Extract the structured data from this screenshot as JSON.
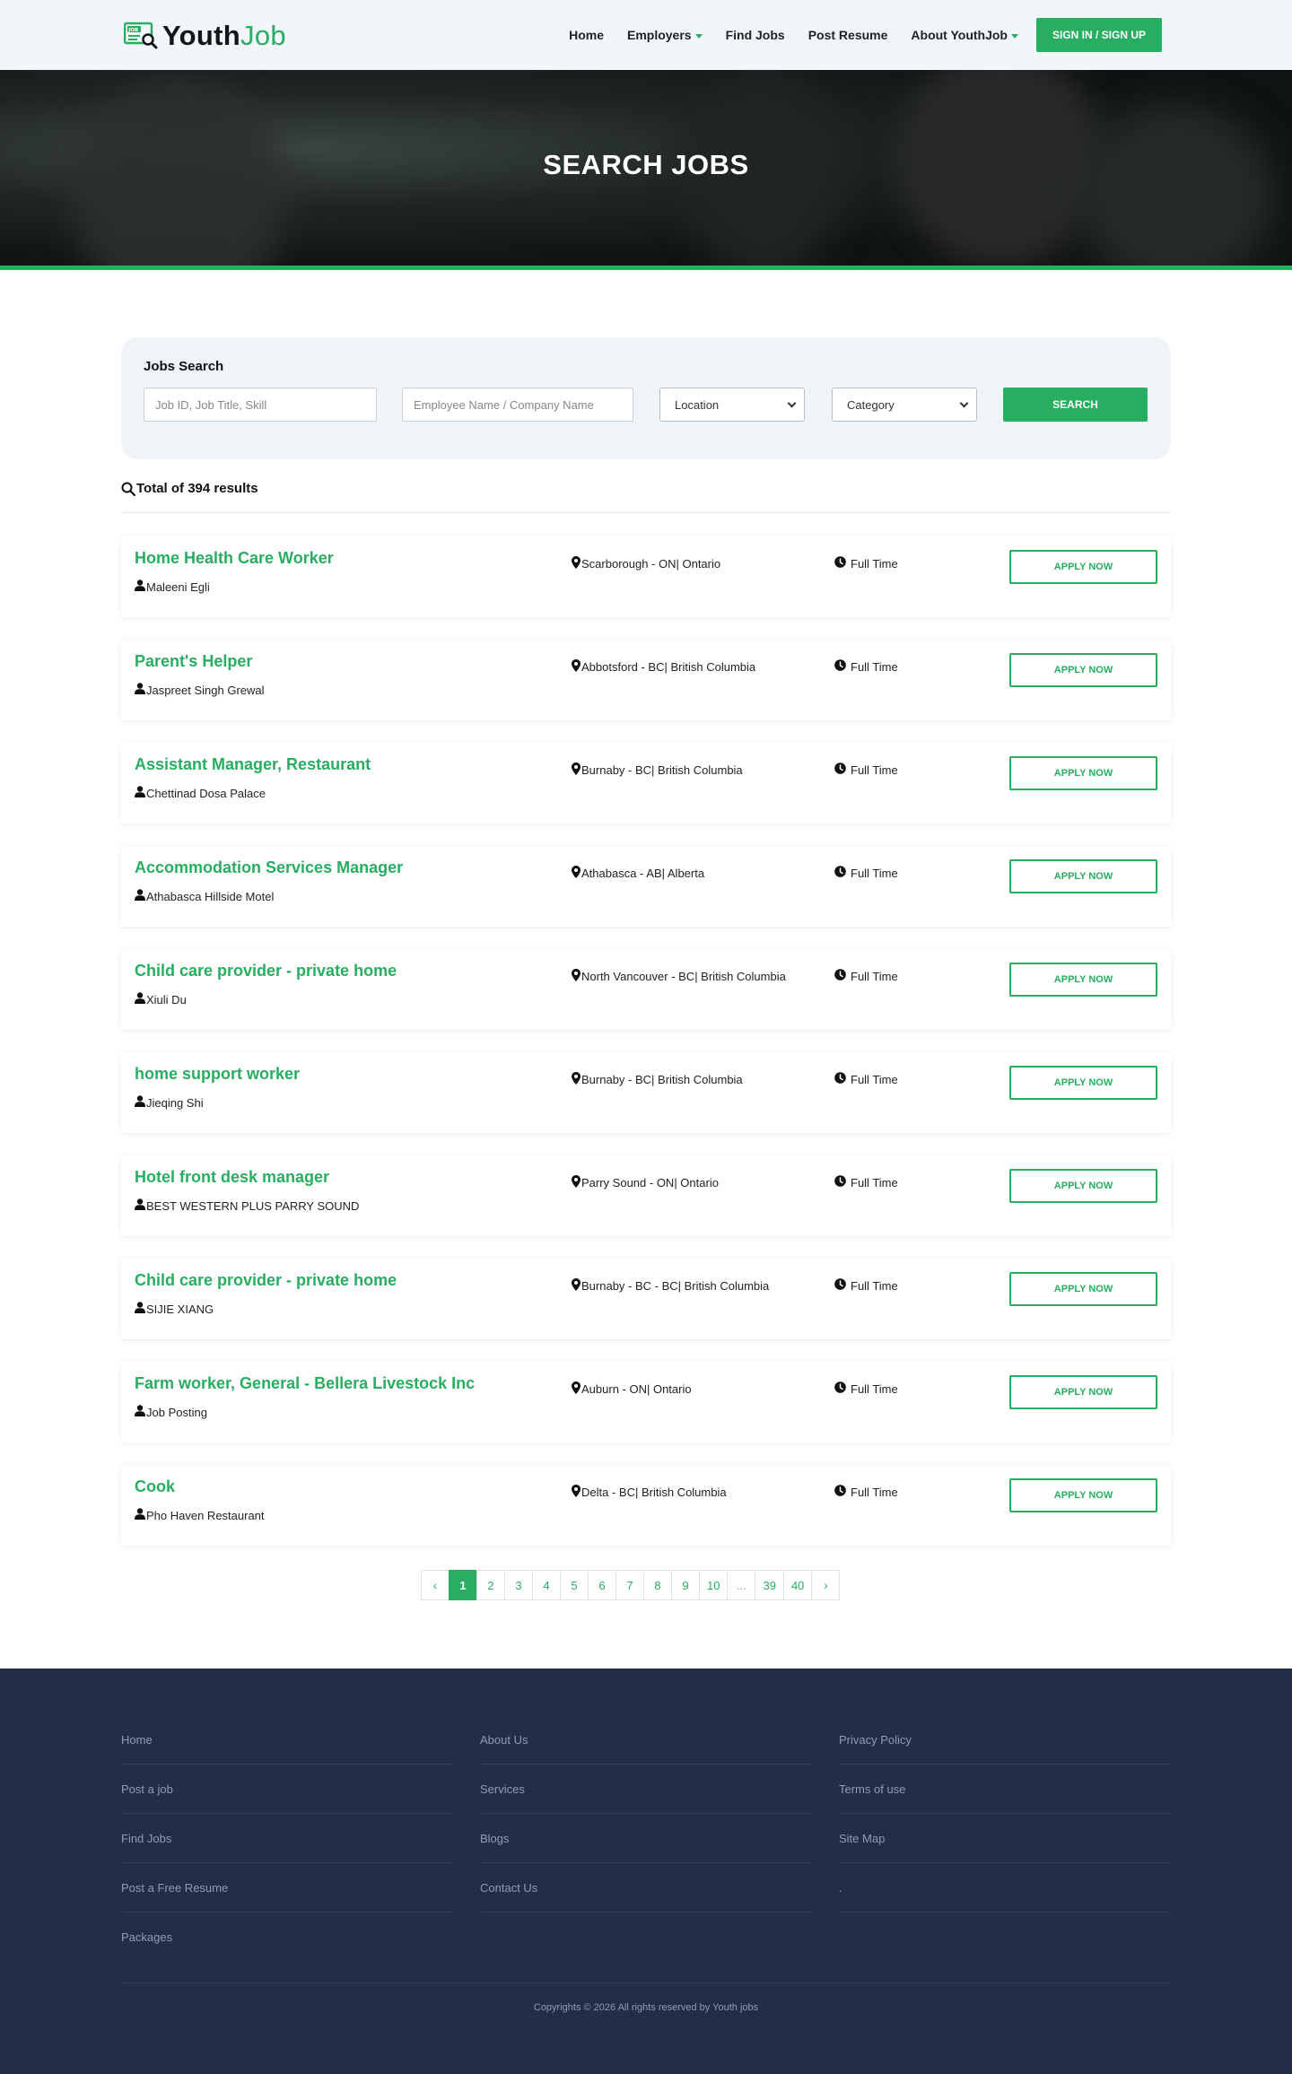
{
  "header": {
    "logo_main": "Youth",
    "logo_accent": "Job",
    "logo_badge": "JOB",
    "nav": [
      {
        "label": "Home",
        "has_caret": false
      },
      {
        "label": "Employers",
        "has_caret": true
      },
      {
        "label": "Find Jobs",
        "has_caret": false
      },
      {
        "label": "Post Resume",
        "has_caret": false
      },
      {
        "label": "About YouthJob",
        "has_caret": true
      }
    ],
    "signin_label": "SIGN IN / SIGN UP"
  },
  "hero": {
    "title": "SEARCH JOBS"
  },
  "search": {
    "label": "Jobs Search",
    "keyword_placeholder": "Job ID, Job Title, Skill",
    "company_placeholder": "Employee Name / Company Name",
    "location_value": "Location",
    "category_value": "Category",
    "button_label": "SEARCH"
  },
  "results": {
    "total_label": "Total of 394 results"
  },
  "jobs": [
    {
      "title": "Home Health Care Worker",
      "company": "Maleeni Egli",
      "location": "Scarborough - ON| Ontario",
      "type": "Full Time",
      "apply": "APPLY NOW"
    },
    {
      "title": "Parent's Helper",
      "company": "Jaspreet Singh Grewal",
      "location": "Abbotsford - BC| British Columbia",
      "type": "Full Time",
      "apply": "APPLY NOW"
    },
    {
      "title": "Assistant Manager, Restaurant",
      "company": "Chettinad Dosa Palace",
      "location": "Burnaby - BC| British Columbia",
      "type": "Full Time",
      "apply": "APPLY NOW"
    },
    {
      "title": "Accommodation Services Manager",
      "company": "Athabasca Hillside Motel",
      "location": "Athabasca - AB| Alberta",
      "type": "Full Time",
      "apply": "APPLY NOW"
    },
    {
      "title": "Child care provider - private home",
      "company": "Xiuli Du",
      "location": "North Vancouver - BC| British Columbia",
      "type": "Full Time",
      "apply": "APPLY NOW"
    },
    {
      "title": "home support worker",
      "company": "Jieqing Shi",
      "location": "Burnaby - BC| British Columbia",
      "type": "Full Time",
      "apply": "APPLY NOW"
    },
    {
      "title": "Hotel front desk manager",
      "company": "BEST WESTERN PLUS PARRY SOUND",
      "location": "Parry Sound - ON| Ontario",
      "type": "Full Time",
      "apply": "APPLY NOW"
    },
    {
      "title": "Child care provider - private home",
      "company": "SIJIE XIANG",
      "location": "Burnaby - BC - BC| British Columbia",
      "type": "Full Time",
      "apply": "APPLY NOW"
    },
    {
      "title": "Farm worker, General - Bellera Livestock Inc",
      "company": "Job Posting",
      "location": "Auburn - ON| Ontario",
      "type": "Full Time",
      "apply": "APPLY NOW"
    },
    {
      "title": "Cook",
      "company": "Pho Haven Restaurant",
      "location": "Delta - BC| British Columbia",
      "type": "Full Time",
      "apply": "APPLY NOW"
    }
  ],
  "pagination": {
    "prev": "‹",
    "next": "›",
    "pages": [
      "1",
      "2",
      "3",
      "4",
      "5",
      "6",
      "7",
      "8",
      "9",
      "10",
      "...",
      "39",
      "40"
    ],
    "current": "1"
  },
  "footer": {
    "col1": [
      "Home",
      "Post a job",
      "Find Jobs",
      "Post a Free Resume",
      "Packages"
    ],
    "col2": [
      "About Us",
      "Services",
      "Blogs",
      "Contact Us"
    ],
    "col3": [
      "Privacy Policy",
      "Terms of use",
      "Site Map",
      "."
    ],
    "copyright": "Copyrights © 2026 All rights reserved by Youth jobs"
  },
  "colors": {
    "accent": "#27ae60",
    "footer_bg": "#222d48",
    "header_bg": "#f1f6fa",
    "search_bg": "#eef4f8"
  }
}
